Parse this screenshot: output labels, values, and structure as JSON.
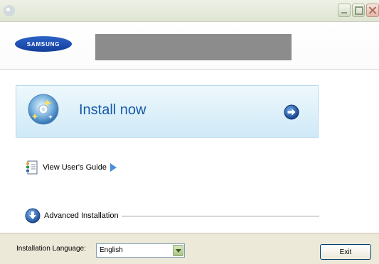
{
  "window": {
    "title": "",
    "controls": [
      "minimize",
      "maximize",
      "close"
    ]
  },
  "header": {
    "logo_text": "SAMSUNG",
    "model_name_redacted": ""
  },
  "main": {
    "install_now": {
      "label": "Install now",
      "icon": "cd-disc-icon",
      "arrow_icon": "go-arrow-icon"
    },
    "view_users_guide": {
      "label": "View User's Guide",
      "icon": "document-icon",
      "arrow_icon": "play-arrow-icon"
    },
    "advanced_installation": {
      "label": "Advanced Installation",
      "icon": "download-arrow-icon"
    }
  },
  "footer": {
    "language_label": "Installation Language:",
    "language_value": "English",
    "exit_label": "Exit"
  },
  "colors": {
    "titlebar": "#dfe5d2",
    "install_panel": "#cfe9f7",
    "install_text": "#155aa8",
    "footer": "#ece9d8",
    "logo": "#1a4aa8"
  }
}
